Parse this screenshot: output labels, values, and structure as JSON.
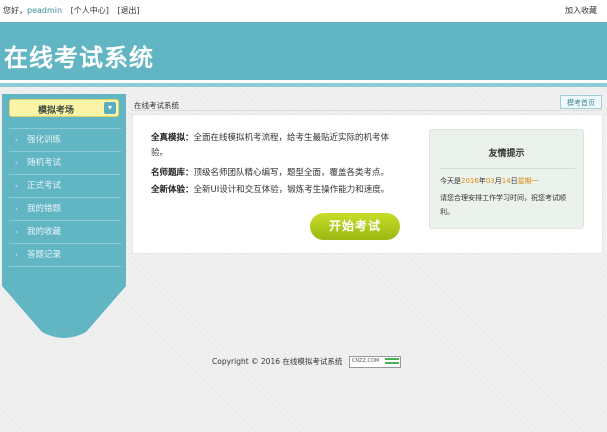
{
  "topbar": {
    "greeting": "您好，",
    "username": "peadmin",
    "user_center": "[个人中心]",
    "logout": "[退出]",
    "favorite": "加入收藏"
  },
  "banner": {
    "title": "在线考试系统"
  },
  "sidebar": {
    "header": "模拟考场",
    "toggle_icon": "chevron-down-icon",
    "items": [
      {
        "label": "强化训练"
      },
      {
        "label": "随机考试"
      },
      {
        "label": "正式考试"
      },
      {
        "label": "我的错题"
      },
      {
        "label": "我的收藏"
      },
      {
        "label": "答题记录"
      }
    ]
  },
  "main": {
    "breadcrumb": "在线考试系统",
    "home_button": "模考首页",
    "features": [
      {
        "title": "全真模拟：",
        "text": "全面在线模拟机考流程，给考生最贴近实际的机考体验。"
      },
      {
        "title": "名师题库：",
        "text": "顶级名师团队精心编写，题型全面，覆盖各类考点。"
      },
      {
        "title": "全新体验：",
        "text": "全新UI设计和交互体验，锻炼考生操作能力和速度。"
      }
    ],
    "start_button": "开始考试"
  },
  "tips": {
    "title": "友情提示",
    "date_prefix": "今天是",
    "year": "2016",
    "y_unit": "年",
    "month": "03",
    "m_unit": "月",
    "day": "14",
    "d_unit": "日",
    "weekday": "星期一",
    "message": "请您合理安排工作学习时间，祝您考试顺利。"
  },
  "footer": {
    "copyright": "Copyright © 2016 在线模拟考试系统",
    "badge": "CNZZ.COM"
  },
  "colors": {
    "banner": "#62b5c3",
    "sidebar": "#62b5c3",
    "start_button": "#a9c41a",
    "accent_orange": "#e08a10"
  }
}
